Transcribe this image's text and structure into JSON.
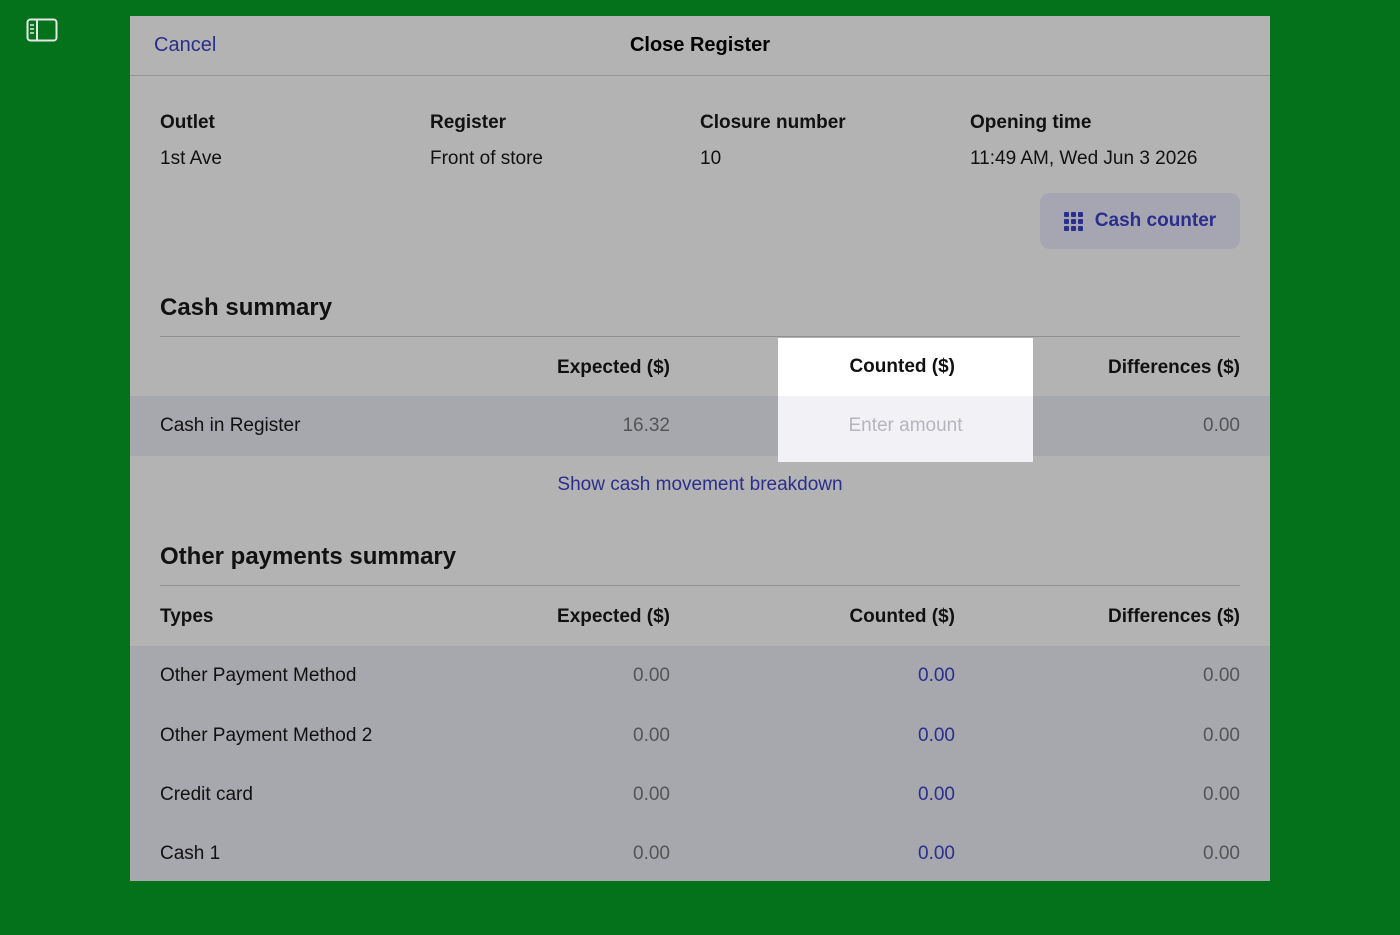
{
  "modal": {
    "cancel_label": "Cancel",
    "title": "Close Register"
  },
  "info": {
    "outlet_label": "Outlet",
    "outlet_value": "1st Ave",
    "register_label": "Register",
    "register_value": "Front of store",
    "closure_label": "Closure number",
    "closure_value": "10",
    "opening_label": "Opening time",
    "opening_value": "11:49 AM, Wed Jun 3 2026"
  },
  "cash_counter": {
    "label": "Cash counter",
    "icon": "grid-icon"
  },
  "cash_summary": {
    "title": "Cash summary",
    "headers": {
      "expected": "Expected ($)",
      "counted": "Counted ($)",
      "differences": "Differences ($)"
    },
    "row": {
      "name": "Cash in Register",
      "expected": "16.32",
      "counted_placeholder": "Enter amount",
      "difference": "0.00"
    },
    "breakdown_link": "Show cash movement breakdown"
  },
  "other_payments": {
    "title": "Other payments summary",
    "headers": {
      "types": "Types",
      "expected": "Expected ($)",
      "counted": "Counted ($)",
      "differences": "Differences ($)"
    },
    "rows": [
      {
        "name": "Other Payment Method",
        "expected": "0.00",
        "counted": "0.00",
        "difference": "0.00"
      },
      {
        "name": "Other Payment Method 2",
        "expected": "0.00",
        "counted": "0.00",
        "difference": "0.00"
      },
      {
        "name": "Credit card",
        "expected": "0.00",
        "counted": "0.00",
        "difference": "0.00"
      },
      {
        "name": "Cash 1",
        "expected": "0.00",
        "counted": "0.00",
        "difference": "0.00"
      }
    ]
  },
  "colors": {
    "background": "#04721a",
    "accent": "#2b2e8c",
    "modal": "#b3b3b3"
  }
}
